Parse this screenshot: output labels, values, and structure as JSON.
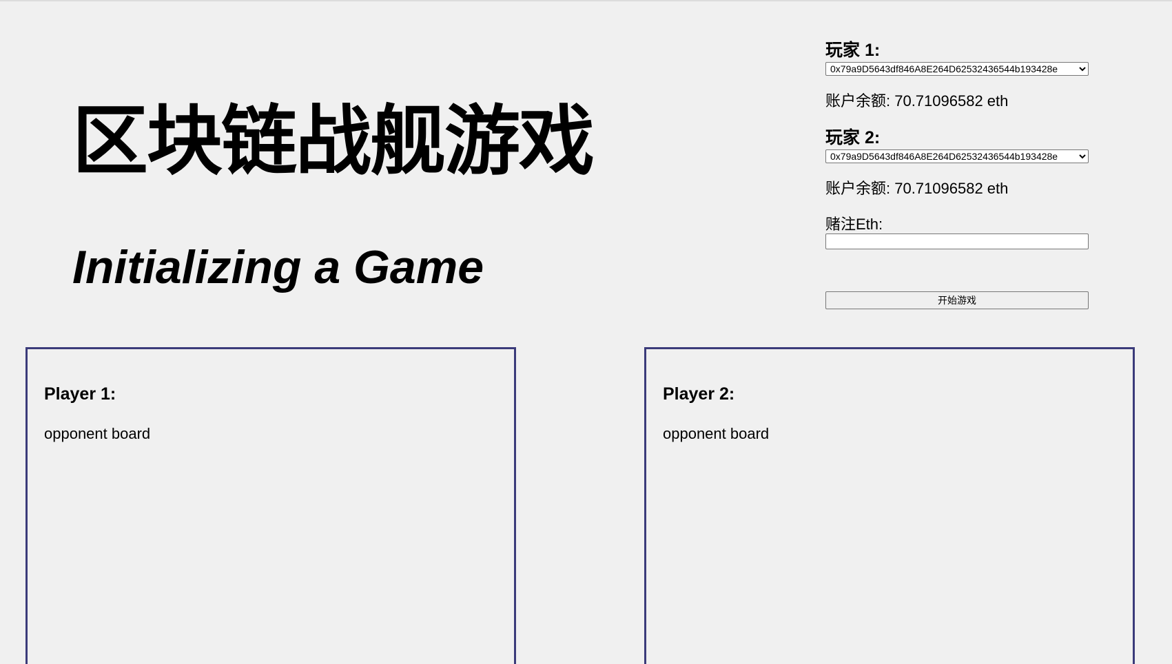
{
  "header": {
    "title": "区块链战舰游戏",
    "subtitle": "Initializing a Game"
  },
  "setup": {
    "player1": {
      "label": "玩家 1:",
      "selected_account": "0x79a9D5643df846A8E264D62532436544b193428e",
      "balance": "账户余额: 70.71096582 eth"
    },
    "player2": {
      "label": "玩家 2:",
      "selected_account": "0x79a9D5643df846A8E264D62532436544b193428e",
      "balance": "账户余额: 70.71096582 eth"
    },
    "stake": {
      "label": "赌注Eth:",
      "value": ""
    },
    "start_button_label": "开始游戏"
  },
  "boards": {
    "player1": {
      "title": "Player 1:",
      "caption": "opponent board"
    },
    "player2": {
      "title": "Player 2:",
      "caption": "opponent board"
    }
  },
  "colors": {
    "background": "#f0f0f0",
    "board_border": "#3b3b7a"
  }
}
